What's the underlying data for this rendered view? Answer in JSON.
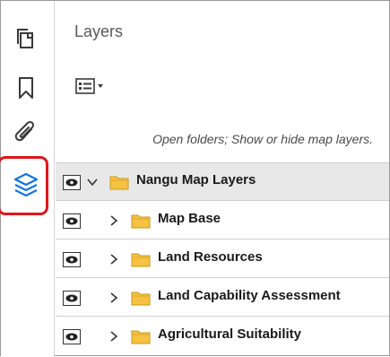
{
  "sidebar": {
    "icons": [
      {
        "name": "pages-icon"
      },
      {
        "name": "bookmark-icon"
      },
      {
        "name": "attachment-icon"
      },
      {
        "name": "layers-icon",
        "active": true
      }
    ]
  },
  "panel": {
    "title": "Layers",
    "options_icon": "list-options-icon",
    "hint": "Open folders; Show or hide map layers."
  },
  "layers": [
    {
      "label": "Nangu Map Layers",
      "expanded": true,
      "visible": true,
      "level": 0
    },
    {
      "label": "Map Base",
      "expanded": false,
      "visible": true,
      "level": 1
    },
    {
      "label": "Land Resources",
      "expanded": false,
      "visible": true,
      "level": 1
    },
    {
      "label": "Land Capability Assessment",
      "expanded": false,
      "visible": true,
      "level": 1
    },
    {
      "label": "Agricultural Suitability",
      "expanded": false,
      "visible": true,
      "level": 1
    }
  ],
  "colors": {
    "accent": "#1473e6",
    "highlight": "#e0151b",
    "folder": "#f5c242"
  }
}
